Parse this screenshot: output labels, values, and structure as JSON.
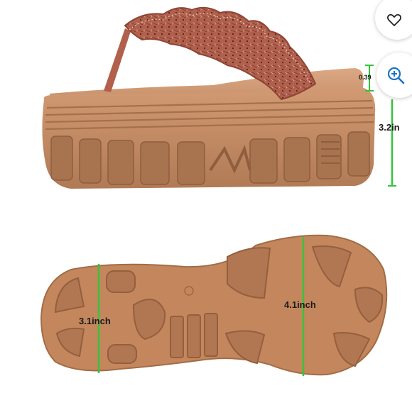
{
  "image": {
    "subject": "platform flip-flop sandal",
    "colors": {
      "sole": "#c08a62",
      "sole_dark": "#9e6c48",
      "strap": "#b0604e",
      "measure_line": "#35c43a"
    }
  },
  "measurements": {
    "side_height_small": "0.39",
    "side_total_height": "3.2in",
    "sole_heel_width": "3.1inch",
    "sole_forefoot_width": "4.1inch"
  },
  "controls": {
    "favorite_icon": "heart-icon",
    "zoom_icon": "zoom-in-icon"
  }
}
